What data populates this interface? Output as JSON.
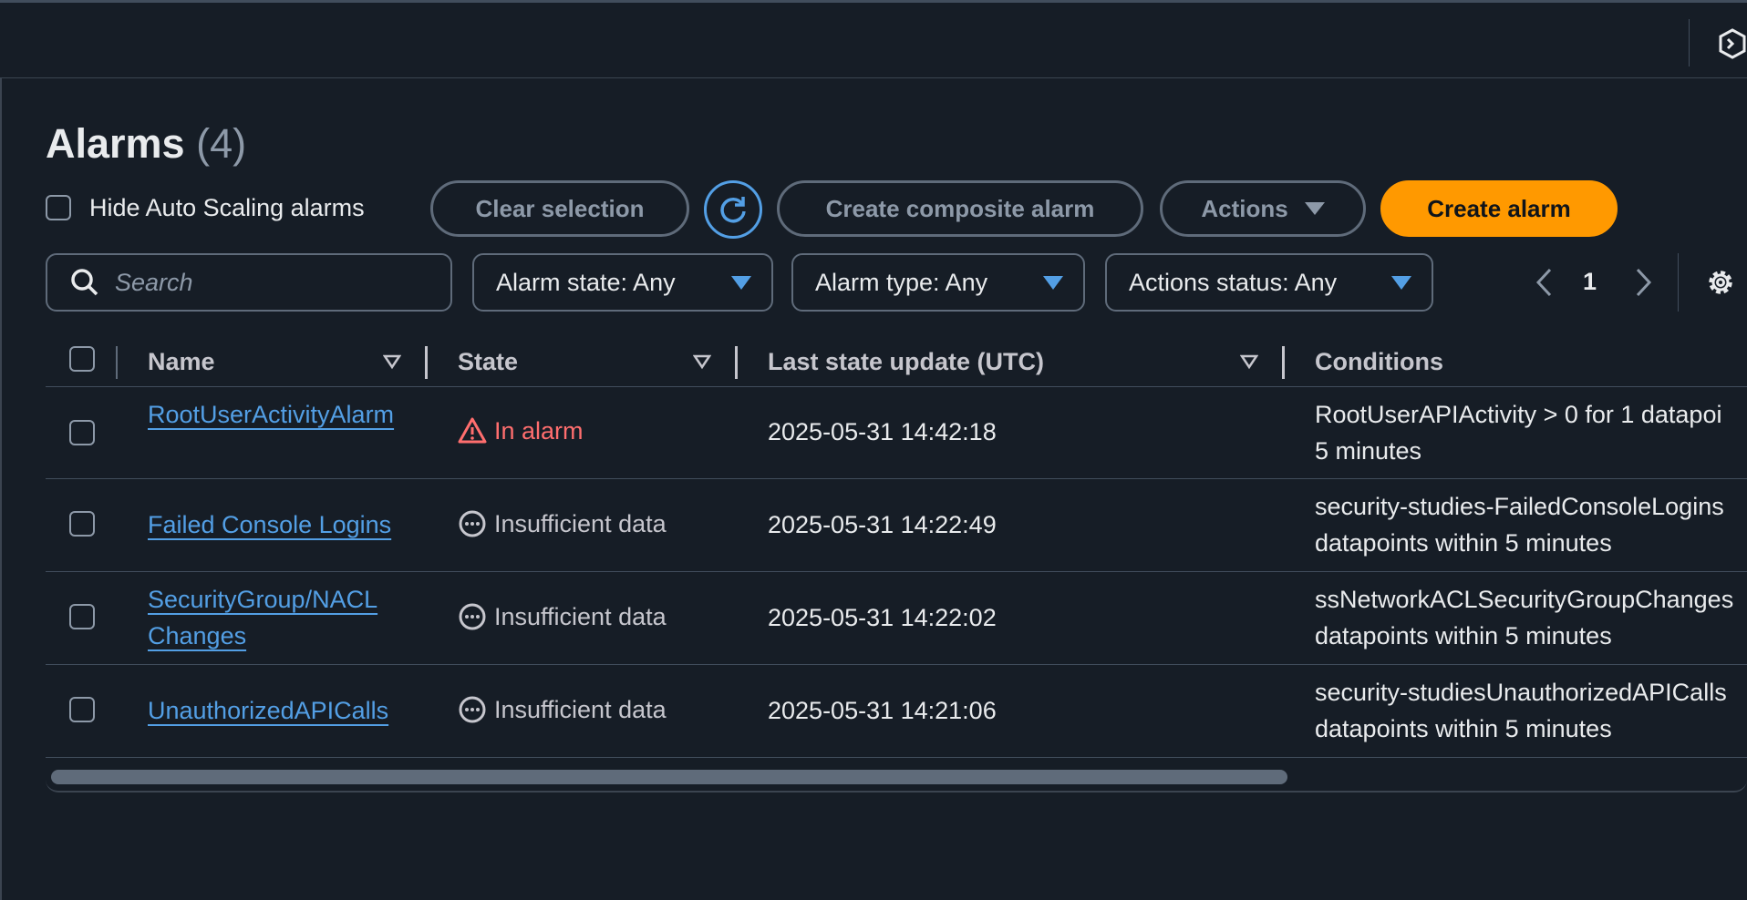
{
  "header": {
    "title": "Alarms",
    "count": "(4)"
  },
  "hide_autoscaling": {
    "label": "Hide Auto Scaling alarms",
    "checked": false
  },
  "toolbar": {
    "clear_selection": "Clear selection",
    "create_composite": "Create composite alarm",
    "actions": "Actions",
    "create_alarm": "Create alarm"
  },
  "search": {
    "placeholder": "Search"
  },
  "filters": {
    "alarm_state": "Alarm state: Any",
    "alarm_type": "Alarm type: Any",
    "actions_status": "Actions status: Any"
  },
  "pagination": {
    "page": "1"
  },
  "table": {
    "headers": {
      "name": "Name",
      "state": "State",
      "updated": "Last state update (UTC)",
      "conditions": "Conditions"
    },
    "rows": [
      {
        "name": "RootUserActivityAlarm",
        "state": "In alarm",
        "state_icon": "warning-icon",
        "updated": "2025-05-31 14:42:18",
        "conditions_1": "RootUserAPIActivity > 0 for 1 datapoi",
        "conditions_2": "5 minutes"
      },
      {
        "name": "Failed Console Logins",
        "state": "Insufficient data",
        "state_icon": "ellipsis-circle-icon",
        "updated": "2025-05-31 14:22:49",
        "conditions_1": "security-studies-FailedConsoleLogins",
        "conditions_2": "datapoints within 5 minutes"
      },
      {
        "name": "SecurityGroup/NACL Changes",
        "state": "Insufficient data",
        "state_icon": "ellipsis-circle-icon",
        "updated": "2025-05-31 14:22:02",
        "conditions_1": "ssNetworkACLSecurityGroupChanges",
        "conditions_2": "datapoints within 5 minutes"
      },
      {
        "name": "UnauthorizedAPICalls",
        "state": "Insufficient data",
        "state_icon": "ellipsis-circle-icon",
        "updated": "2025-05-31 14:21:06",
        "conditions_1": "security-studiesUnauthorizedAPICalls",
        "conditions_2": "datapoints within 5 minutes"
      }
    ]
  },
  "colors": {
    "primary": "#ff9900",
    "link": "#539fe5",
    "alarm": "#ff6e6e",
    "background": "#161d26"
  }
}
